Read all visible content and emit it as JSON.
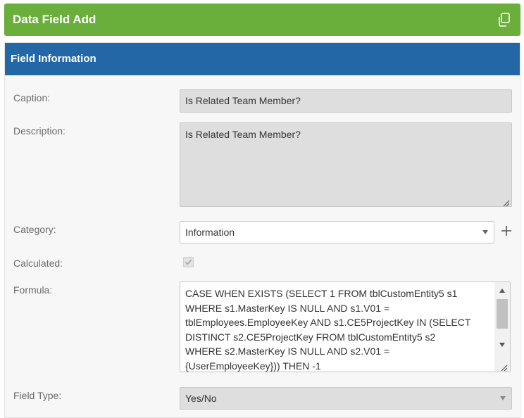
{
  "window": {
    "title": "Data Field Add"
  },
  "section": {
    "title": "Field Information"
  },
  "fields": {
    "caption": {
      "label": "Caption:",
      "value": "Is Related Team Member?"
    },
    "description": {
      "label": "Description:",
      "value": "Is Related Team Member?"
    },
    "category": {
      "label": "Category:",
      "value": "Information"
    },
    "calculated": {
      "label": "Calculated:",
      "checked": true
    },
    "formula": {
      "label": "Formula:",
      "lines": [
        "CASE WHEN EXISTS (SELECT 1 FROM tblCustomEntity5 s1",
        "WHERE s1.MasterKey IS NULL AND s1.V01 =",
        "tblEmployees.EmployeeKey AND s1.CE5ProjectKey IN (SELECT",
        "DISTINCT s2.CE5ProjectKey FROM tblCustomEntity5 s2",
        "WHERE s2.MasterKey IS NULL AND s2.V01 =",
        "{UserEmployeeKey})) THEN -1"
      ]
    },
    "field_type": {
      "label": "Field Type:",
      "value": "Yes/No"
    }
  },
  "colors": {
    "titlebar": "#6aae3c",
    "section_header": "#2467a7"
  },
  "icons": {
    "copy": "copy-icon",
    "add": "plus-icon",
    "dropdown": "chevron-down-icon"
  }
}
